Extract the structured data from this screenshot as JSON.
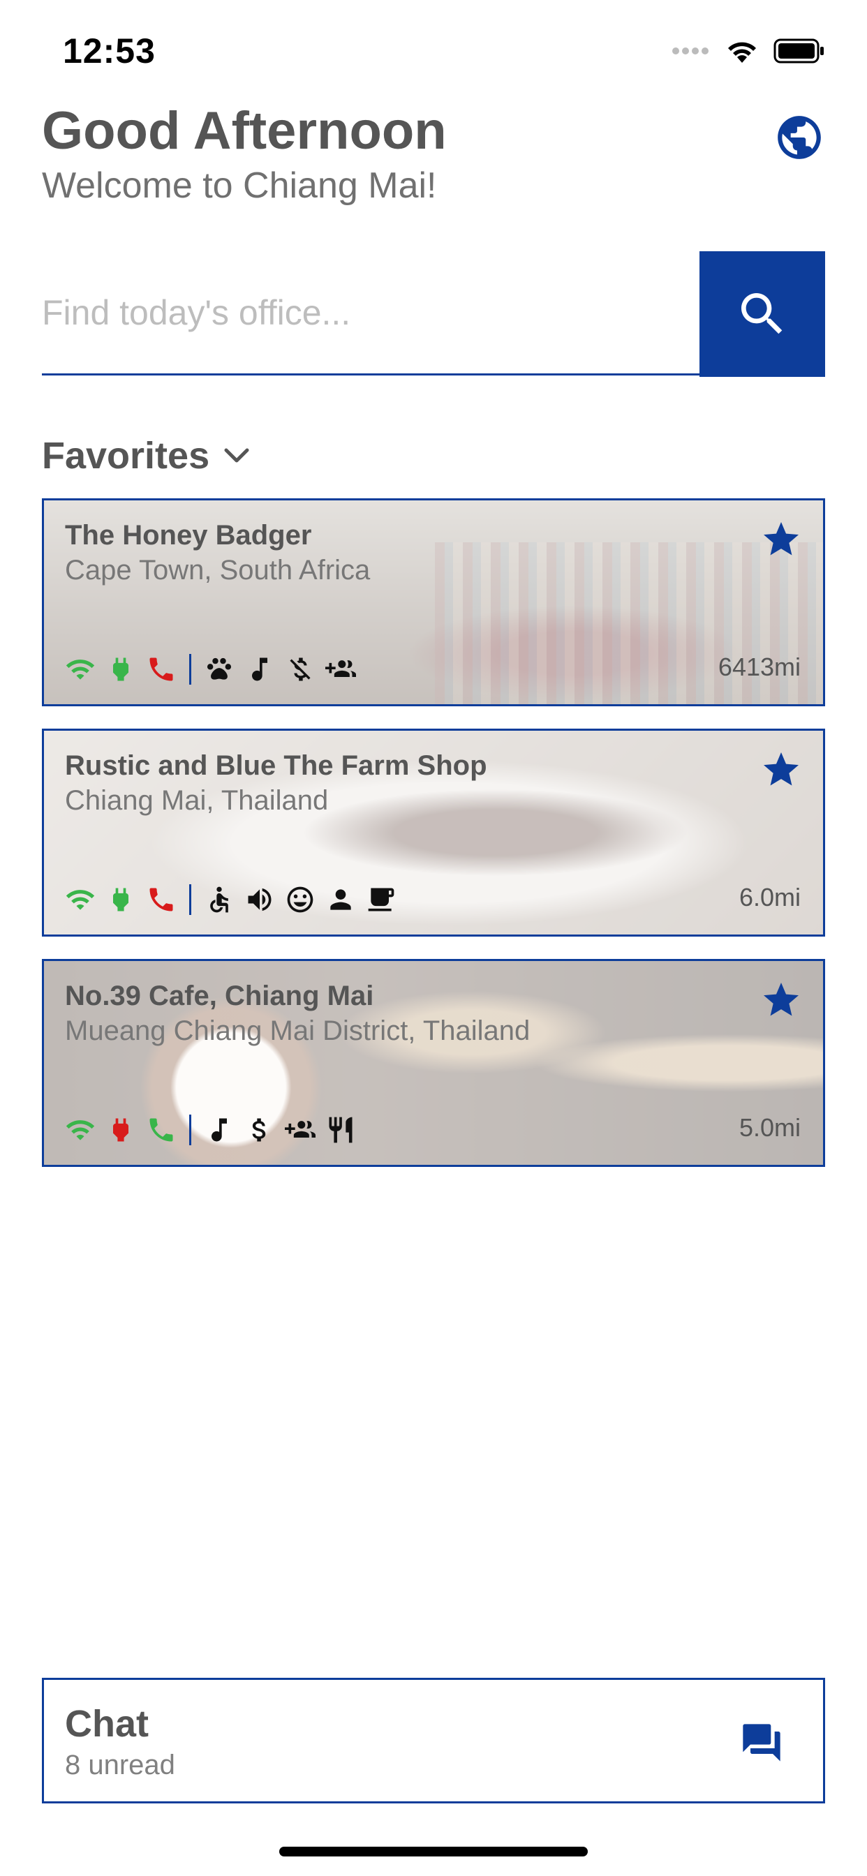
{
  "status_bar": {
    "time": "12:53",
    "icons": [
      "signal-dots-icon",
      "wifi-icon",
      "battery-icon"
    ]
  },
  "header": {
    "title": "Good Afternoon",
    "subtitle": "Welcome to Chiang Mai!",
    "globe_icon": "globe-icon"
  },
  "search": {
    "placeholder": "Find today's office...",
    "value": "",
    "button_icon": "search-icon"
  },
  "favorites": {
    "label": "Favorites",
    "cards": [
      {
        "name": "The Honey Badger",
        "location": "Cape Town, South Africa",
        "distance": "6413mi",
        "starred": true,
        "status_icons": [
          "wifi-green",
          "power-green",
          "phone-red"
        ],
        "amenity_icons": [
          "paw-icon",
          "music-icon",
          "no-money-icon",
          "group-add-icon"
        ]
      },
      {
        "name": "Rustic and Blue The Farm Shop",
        "location": "Chiang Mai, Thailand",
        "distance": "6.0mi",
        "starred": true,
        "status_icons": [
          "wifi-green",
          "power-green",
          "phone-red"
        ],
        "amenity_icons": [
          "accessible-icon",
          "volume-icon",
          "smiley-icon",
          "person-icon",
          "coffee-icon"
        ]
      },
      {
        "name": "No.39 Cafe, Chiang Mai",
        "location": "Mueang Chiang Mai District, Thailand",
        "distance": "5.0mi",
        "starred": true,
        "status_icons": [
          "wifi-green",
          "power-red",
          "phone-green"
        ],
        "amenity_icons": [
          "music-icon",
          "dollar-icon",
          "group-add-icon",
          "restaurant-icon"
        ]
      }
    ]
  },
  "chat": {
    "title": "Chat",
    "unread": "8 unread",
    "icon": "chat-icon"
  },
  "colors": {
    "accent": "#0D3D9A",
    "status_good": "#39B54A",
    "status_bad": "#D81B1B"
  }
}
